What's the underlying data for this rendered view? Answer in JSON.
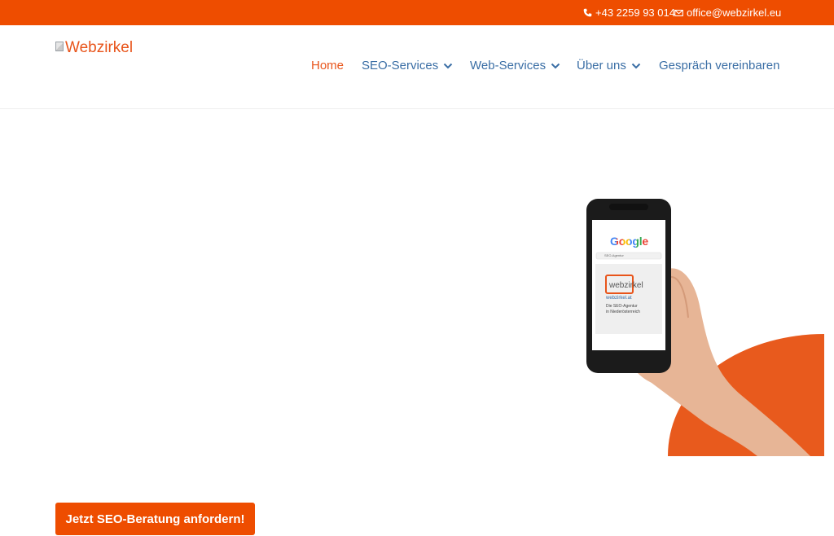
{
  "topbar": {
    "phone": "+43 2259 93 014",
    "email": "office@webzirkel.eu",
    "phone_icon": "phone-icon",
    "mail_icon": "envelope-icon"
  },
  "header": {
    "logo_alt": "Webzirkel"
  },
  "nav": {
    "items": [
      {
        "label": "Home",
        "active": true
      },
      {
        "label": "SEO-Services",
        "dropdown": true
      },
      {
        "label": "Web-Services",
        "dropdown": true
      },
      {
        "label": "Über uns",
        "dropdown": true
      },
      {
        "label": "Gespräch vereinbaren"
      }
    ]
  },
  "hero": {
    "phone_screen": {
      "search_brand": "Google",
      "search_query": "SEO-Agentur",
      "result_brand": "webzirkel",
      "result_url": "webzirkel.at",
      "result_line1": "Die SEO-Agentur",
      "result_line2": "in Niederösterreich"
    },
    "cta_label": "Jetzt SEO-Beratung anfordern!"
  },
  "colors": {
    "accent": "#ee4d00",
    "link": "#3a6ea5"
  }
}
